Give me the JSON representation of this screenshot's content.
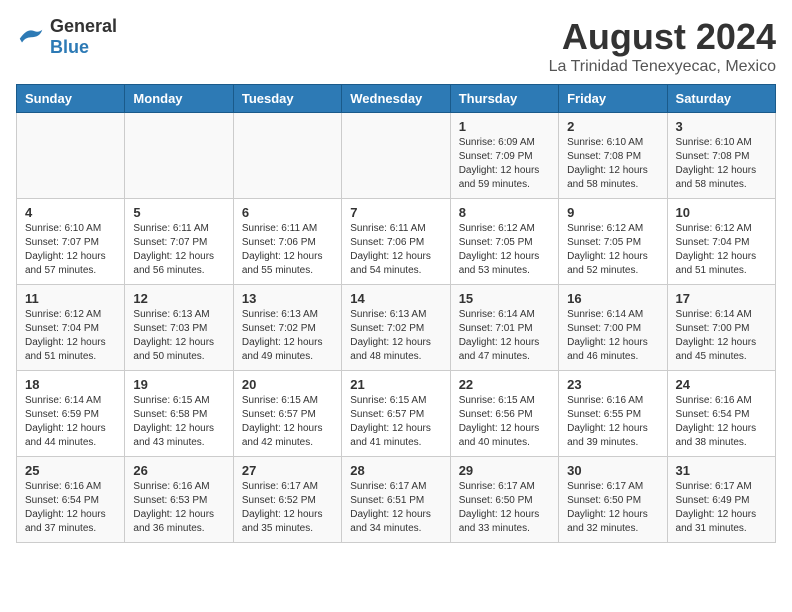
{
  "logo": {
    "general": "General",
    "blue": "Blue"
  },
  "title": "August 2024",
  "subtitle": "La Trinidad Tenexyecac, Mexico",
  "days_of_week": [
    "Sunday",
    "Monday",
    "Tuesday",
    "Wednesday",
    "Thursday",
    "Friday",
    "Saturday"
  ],
  "weeks": [
    [
      {
        "day": "",
        "info": ""
      },
      {
        "day": "",
        "info": ""
      },
      {
        "day": "",
        "info": ""
      },
      {
        "day": "",
        "info": ""
      },
      {
        "day": "1",
        "info": "Sunrise: 6:09 AM\nSunset: 7:09 PM\nDaylight: 12 hours and 59 minutes."
      },
      {
        "day": "2",
        "info": "Sunrise: 6:10 AM\nSunset: 7:08 PM\nDaylight: 12 hours and 58 minutes."
      },
      {
        "day": "3",
        "info": "Sunrise: 6:10 AM\nSunset: 7:08 PM\nDaylight: 12 hours and 58 minutes."
      }
    ],
    [
      {
        "day": "4",
        "info": "Sunrise: 6:10 AM\nSunset: 7:07 PM\nDaylight: 12 hours and 57 minutes."
      },
      {
        "day": "5",
        "info": "Sunrise: 6:11 AM\nSunset: 7:07 PM\nDaylight: 12 hours and 56 minutes."
      },
      {
        "day": "6",
        "info": "Sunrise: 6:11 AM\nSunset: 7:06 PM\nDaylight: 12 hours and 55 minutes."
      },
      {
        "day": "7",
        "info": "Sunrise: 6:11 AM\nSunset: 7:06 PM\nDaylight: 12 hours and 54 minutes."
      },
      {
        "day": "8",
        "info": "Sunrise: 6:12 AM\nSunset: 7:05 PM\nDaylight: 12 hours and 53 minutes."
      },
      {
        "day": "9",
        "info": "Sunrise: 6:12 AM\nSunset: 7:05 PM\nDaylight: 12 hours and 52 minutes."
      },
      {
        "day": "10",
        "info": "Sunrise: 6:12 AM\nSunset: 7:04 PM\nDaylight: 12 hours and 51 minutes."
      }
    ],
    [
      {
        "day": "11",
        "info": "Sunrise: 6:12 AM\nSunset: 7:04 PM\nDaylight: 12 hours and 51 minutes."
      },
      {
        "day": "12",
        "info": "Sunrise: 6:13 AM\nSunset: 7:03 PM\nDaylight: 12 hours and 50 minutes."
      },
      {
        "day": "13",
        "info": "Sunrise: 6:13 AM\nSunset: 7:02 PM\nDaylight: 12 hours and 49 minutes."
      },
      {
        "day": "14",
        "info": "Sunrise: 6:13 AM\nSunset: 7:02 PM\nDaylight: 12 hours and 48 minutes."
      },
      {
        "day": "15",
        "info": "Sunrise: 6:14 AM\nSunset: 7:01 PM\nDaylight: 12 hours and 47 minutes."
      },
      {
        "day": "16",
        "info": "Sunrise: 6:14 AM\nSunset: 7:00 PM\nDaylight: 12 hours and 46 minutes."
      },
      {
        "day": "17",
        "info": "Sunrise: 6:14 AM\nSunset: 7:00 PM\nDaylight: 12 hours and 45 minutes."
      }
    ],
    [
      {
        "day": "18",
        "info": "Sunrise: 6:14 AM\nSunset: 6:59 PM\nDaylight: 12 hours and 44 minutes."
      },
      {
        "day": "19",
        "info": "Sunrise: 6:15 AM\nSunset: 6:58 PM\nDaylight: 12 hours and 43 minutes."
      },
      {
        "day": "20",
        "info": "Sunrise: 6:15 AM\nSunset: 6:57 PM\nDaylight: 12 hours and 42 minutes."
      },
      {
        "day": "21",
        "info": "Sunrise: 6:15 AM\nSunset: 6:57 PM\nDaylight: 12 hours and 41 minutes."
      },
      {
        "day": "22",
        "info": "Sunrise: 6:15 AM\nSunset: 6:56 PM\nDaylight: 12 hours and 40 minutes."
      },
      {
        "day": "23",
        "info": "Sunrise: 6:16 AM\nSunset: 6:55 PM\nDaylight: 12 hours and 39 minutes."
      },
      {
        "day": "24",
        "info": "Sunrise: 6:16 AM\nSunset: 6:54 PM\nDaylight: 12 hours and 38 minutes."
      }
    ],
    [
      {
        "day": "25",
        "info": "Sunrise: 6:16 AM\nSunset: 6:54 PM\nDaylight: 12 hours and 37 minutes."
      },
      {
        "day": "26",
        "info": "Sunrise: 6:16 AM\nSunset: 6:53 PM\nDaylight: 12 hours and 36 minutes."
      },
      {
        "day": "27",
        "info": "Sunrise: 6:17 AM\nSunset: 6:52 PM\nDaylight: 12 hours and 35 minutes."
      },
      {
        "day": "28",
        "info": "Sunrise: 6:17 AM\nSunset: 6:51 PM\nDaylight: 12 hours and 34 minutes."
      },
      {
        "day": "29",
        "info": "Sunrise: 6:17 AM\nSunset: 6:50 PM\nDaylight: 12 hours and 33 minutes."
      },
      {
        "day": "30",
        "info": "Sunrise: 6:17 AM\nSunset: 6:50 PM\nDaylight: 12 hours and 32 minutes."
      },
      {
        "day": "31",
        "info": "Sunrise: 6:17 AM\nSunset: 6:49 PM\nDaylight: 12 hours and 31 minutes."
      }
    ]
  ]
}
